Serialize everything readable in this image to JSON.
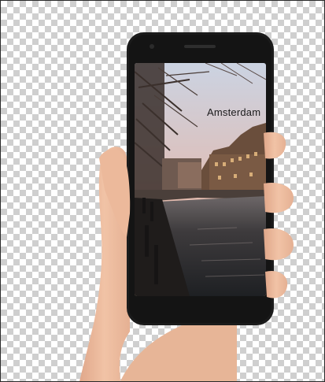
{
  "photo": {
    "overlay_text": "Amsterdam",
    "description_icon": "phone-in-hand-icon"
  },
  "colors": {
    "checker_light": "#ffffff",
    "checker_dark": "#cfcfcf",
    "phone_body": "#1c1c1c",
    "sky_top": "#cfd6e3",
    "sky_glow": "#e9b9a8",
    "water": "#2a2f33",
    "skin": "#e9b79a"
  }
}
